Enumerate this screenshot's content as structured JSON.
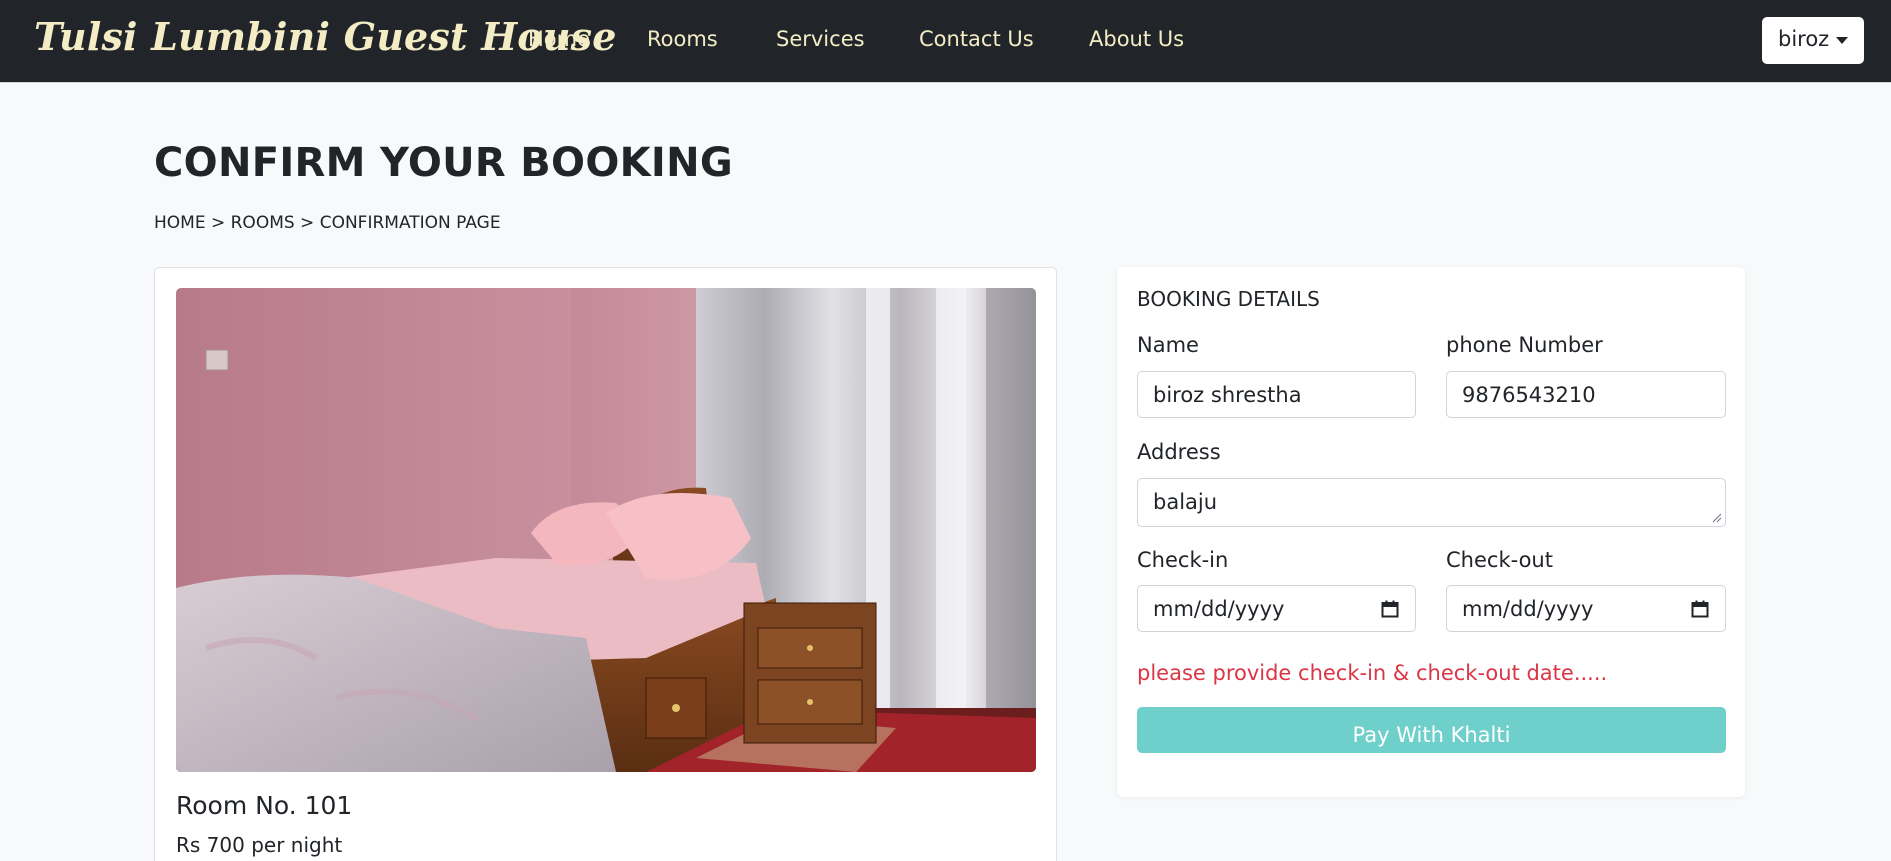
{
  "navbar": {
    "brand": "Tulsi Lumbini Guest House",
    "links": [
      "Home",
      "Rooms",
      "Services",
      "Contact Us",
      "About Us"
    ],
    "user": "biroz"
  },
  "header": {
    "title": "CONFIRM YOUR BOOKING",
    "breadcrumb": "HOME > ROOMS > CONFIRMATION PAGE"
  },
  "room": {
    "name": "Room No. 101",
    "price": "Rs 700 per night"
  },
  "booking": {
    "heading": "BOOKING DETAILS",
    "name_label": "Name",
    "name_value": "biroz shrestha",
    "phone_label": "phone Number",
    "phone_value": "9876543210",
    "address_label": "Address",
    "address_value": "balaju",
    "checkin_label": "Check-in",
    "checkin_placeholder": "mm/dd/yyyy",
    "checkout_label": "Check-out",
    "checkout_placeholder": "mm/dd/yyyy",
    "error": "please provide check-in & check-out date.....",
    "pay_button": "Pay With Khalti"
  },
  "colors": {
    "navbar_bg": "#212529",
    "nav_text": "#f4ecc4",
    "error": "#dc3545",
    "pay_button": "#6fcfcb"
  }
}
